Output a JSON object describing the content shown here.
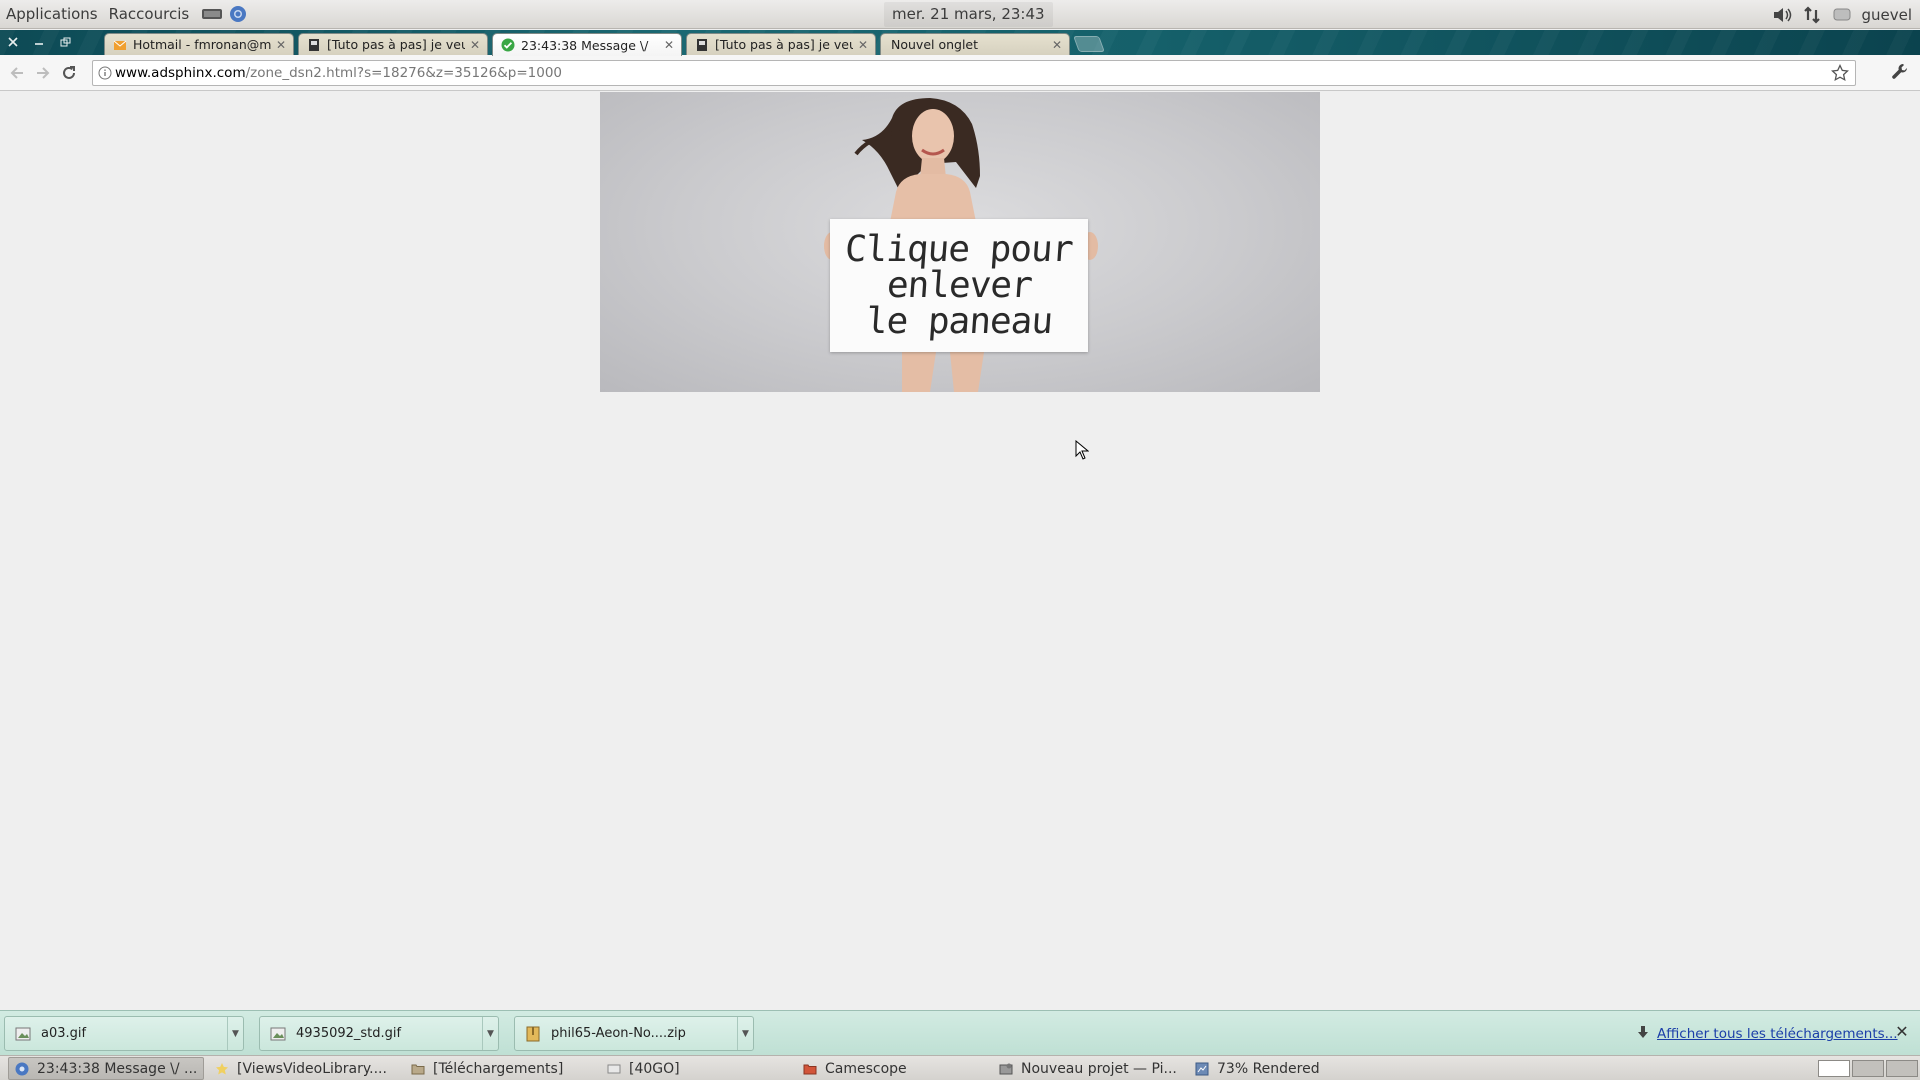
{
  "top_panel": {
    "applications_label": "Applications",
    "shortcuts_label": "Raccourcis",
    "clock": "mer. 21 mars, 23:43",
    "user": "guevel"
  },
  "tabs": [
    {
      "title": "Hotmail - fmronan@msn.c",
      "icon": "hotmail-icon",
      "active": false
    },
    {
      "title": "[Tuto pas à pas] je veux un",
      "icon": "forum-icon",
      "active": false
    },
    {
      "title": "23:43:38 Message \\/",
      "icon": "check-icon",
      "active": true
    },
    {
      "title": "[Tuto pas à pas] je veux un",
      "icon": "forum-icon",
      "active": false
    },
    {
      "title": "Nouvel onglet",
      "icon": "",
      "active": false
    }
  ],
  "address_bar": {
    "host": "www.adsphinx.com",
    "path": "/zone_dsn2.html?s=18276&z=35126&p=1000"
  },
  "ad": {
    "sign_line1": "Clique pour",
    "sign_line2": "enlever",
    "sign_line3": "le paneau"
  },
  "downloads": {
    "items": [
      {
        "name": "a03.gif",
        "icon": "image-file-icon"
      },
      {
        "name": "4935092_std.gif",
        "icon": "image-file-icon"
      },
      {
        "name": "phil65-Aeon-No....zip",
        "icon": "archive-file-icon"
      }
    ],
    "show_all_label": "Afficher tous les téléchargements..."
  },
  "taskbar": {
    "tasks": [
      {
        "label": "23:43:38 Message \\/ ...",
        "icon": "chrome-icon",
        "active": true
      },
      {
        "label": "[ViewsVideoLibrary....",
        "icon": "star-icon",
        "active": false
      },
      {
        "label": "[Téléchargements]",
        "icon": "folder-icon",
        "active": false
      },
      {
        "label": "[40GO]",
        "icon": "drive-icon",
        "active": false
      },
      {
        "label": "Camescope",
        "icon": "folder-icon",
        "active": false
      },
      {
        "label": "Nouveau projet — Pi...",
        "icon": "video-editor-icon",
        "active": false
      },
      {
        "label": "73% Rendered",
        "icon": "render-icon",
        "active": false
      }
    ]
  },
  "colors": {
    "tabstrip": "#15606a",
    "download_shelf": "#c8e6da",
    "link": "#1b3ea8"
  }
}
